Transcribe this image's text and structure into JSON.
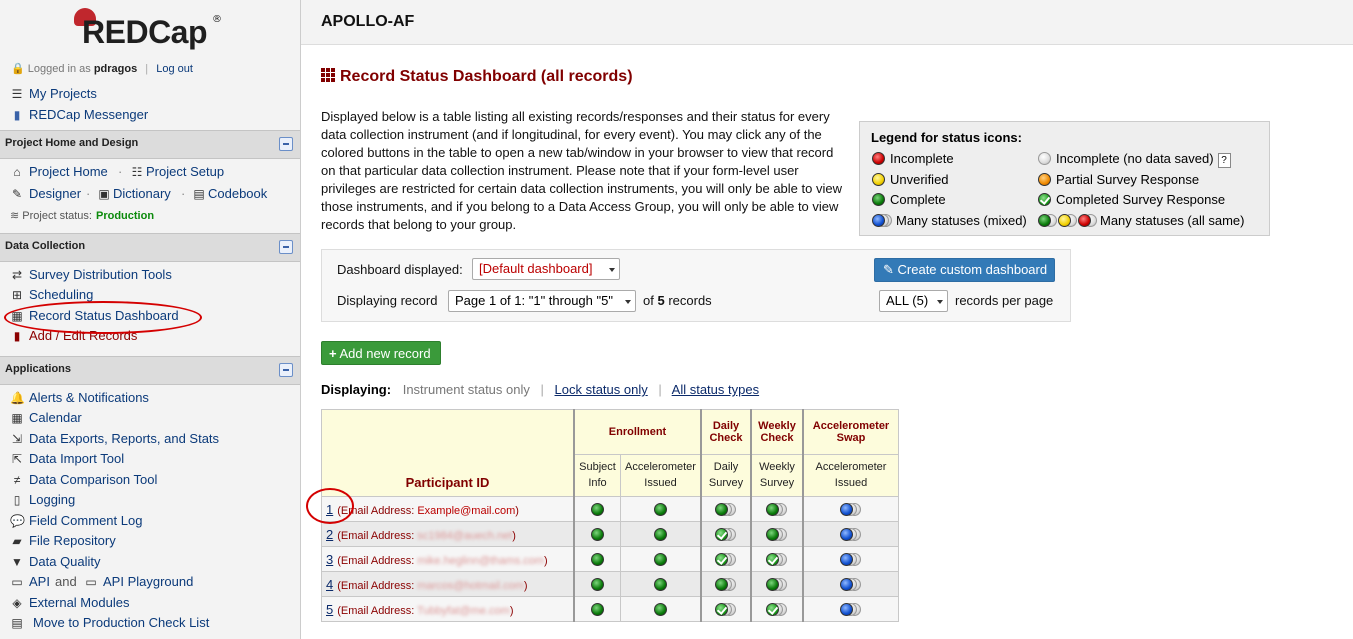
{
  "app": {
    "logo_text": "REDCap",
    "logo_mark": "®"
  },
  "user": {
    "logged_in_prefix": "Logged in as",
    "username": "pdragos",
    "separator": "|",
    "logout": "Log out"
  },
  "sidebar": {
    "top_links": [
      {
        "label": "My Projects",
        "icon": "list-icon"
      },
      {
        "label": "REDCap Messenger",
        "icon": "message-icon"
      }
    ],
    "sections": {
      "home": {
        "title": "Project Home and Design",
        "project_home": "Project Home",
        "project_setup": "Project Setup",
        "designer": "Designer",
        "dictionary": "Dictionary",
        "codebook": "Codebook",
        "status_label": "Project status:",
        "status_value": "Production",
        "dot": "·"
      },
      "data_collection": {
        "title": "Data Collection",
        "items": [
          "Survey Distribution Tools",
          "Scheduling",
          "Record Status Dashboard",
          "Add / Edit Records"
        ]
      },
      "applications": {
        "title": "Applications",
        "items": [
          "Alerts & Notifications",
          "Calendar",
          "Data Exports, Reports, and Stats",
          "Data Import Tool",
          "Data Comparison Tool",
          "Logging",
          "Field Comment Log",
          "File Repository",
          "Data Quality"
        ],
        "api": "API",
        "and": "and",
        "api_playground": "API Playground",
        "external_modules": "External Modules",
        "move_to_production": "Move to Production Check List"
      }
    }
  },
  "header": {
    "project_title": "APOLLO-AF"
  },
  "main": {
    "page_title": "Record Status Dashboard (all records)",
    "description": "Displayed below is a table listing all existing records/responses and their status for every data collection instrument (and if longitudinal, for every event). You may click any of the colored buttons in the table to open a new tab/window in your browser to view that record on that particular data collection instrument. Please note that if your form-level user privileges are restricted for certain data collection instruments, you will only be able to view those instruments, and if you belong to a Data Access Group, you will only be able to view records that belong to your group.",
    "legend": {
      "title": "Legend for status icons:",
      "incomplete": "Incomplete",
      "incomplete_no_data": "Incomplete (no data saved)",
      "unverified": "Unverified",
      "partial": "Partial Survey Response",
      "complete": "Complete",
      "completed_survey": "Completed Survey Response",
      "many_mixed": "Many statuses (mixed)",
      "many_same": "Many statuses (all same)",
      "help": "?"
    },
    "controls": {
      "dashboard_label": "Dashboard displayed:",
      "dashboard_value": "[Default dashboard]",
      "create_button": "Create custom dashboard",
      "displaying_label": "Displaying record",
      "page_value": "Page 1 of 1: \"1\" through \"5\"",
      "of_text": "of",
      "record_count": "5",
      "records_text": "records",
      "per_page_value": "ALL (5)",
      "per_page_label": "records per page"
    },
    "add_record": "Add new record",
    "displaying": {
      "label": "Displaying:",
      "option_active": "Instrument status only",
      "sep": "|",
      "lock_status": "Lock status only",
      "all_status": "All status types"
    },
    "table": {
      "participant_header": "Participant ID",
      "events": [
        "Enrollment",
        "Daily Check",
        "Weekly Check",
        "Accelerometer Swap"
      ],
      "instruments": [
        "Subject Info",
        "Accelerometer Issued",
        "Daily Survey",
        "Weekly Survey",
        "Accelerometer Issued"
      ],
      "email_prefix": "(Email Address:",
      "email_suffix": ")",
      "rows": [
        {
          "id": "1",
          "email": "Example@mail.com",
          "statuses": [
            "complete",
            "complete",
            "many_complete",
            "many_complete",
            "many_mixed"
          ]
        },
        {
          "id": "2",
          "email": "sc1984@auech.net",
          "statuses": [
            "complete",
            "complete",
            "many_survey",
            "many_complete",
            "many_mixed"
          ]
        },
        {
          "id": "3",
          "email": "mike.heglinn@thams.com",
          "statuses": [
            "complete",
            "complete",
            "many_survey",
            "many_survey",
            "many_mixed"
          ]
        },
        {
          "id": "4",
          "email": "marcos@hotmail.com",
          "statuses": [
            "complete",
            "complete",
            "many_complete",
            "many_complete",
            "many_mixed"
          ]
        },
        {
          "id": "5",
          "email": "Tubbyfat@me.com",
          "statuses": [
            "complete",
            "complete",
            "many_survey",
            "many_survey",
            "many_mixed"
          ]
        }
      ]
    }
  },
  "colors": {
    "brand_red": "#800000",
    "link_blue": "#0b3a7a",
    "production_green": "#0b8a0b",
    "button_blue": "#337ab7",
    "button_green": "#3a9a3a"
  }
}
